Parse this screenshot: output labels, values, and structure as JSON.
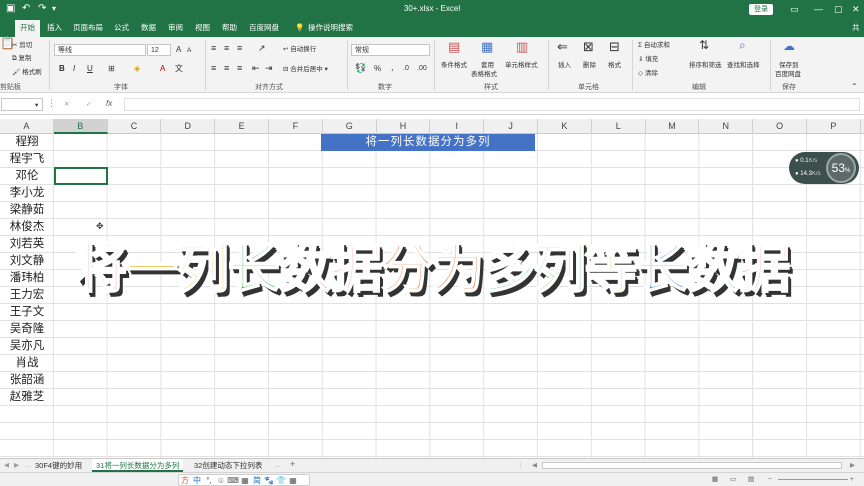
{
  "titlebar": {
    "window_title": "30+.xlsx - Excel",
    "login_label": "登录"
  },
  "tabs": [
    "开始",
    "插入",
    "页面布局",
    "公式",
    "数据",
    "审阅",
    "视图",
    "帮助",
    "百度网盘",
    "操作说明搜索"
  ],
  "active_tab": 0,
  "ribbon": {
    "clipboard": {
      "cut": "剪切",
      "copy": "复制",
      "format_painter": "格式刷",
      "group": "剪贴板"
    },
    "font": {
      "name": "等线",
      "size": "12",
      "grow": "A",
      "shrink": "A",
      "bold": "B",
      "italic": "I",
      "underline": "U",
      "group": "字体"
    },
    "alignment": {
      "wrap": "自动换行",
      "merge": "合并后居中",
      "group": "对齐方式"
    },
    "number": {
      "format": "常规",
      "percent": "%",
      "comma": ",",
      "group": "数字"
    },
    "styles": {
      "conditional": "条件格式",
      "table": "套用",
      "table2": "表格格式",
      "cell_styles": "单元格样式",
      "group": "样式"
    },
    "cells": {
      "insert": "插入",
      "delete": "删除",
      "format": "格式",
      "group": "单元格"
    },
    "editing": {
      "autosum": "自动求和",
      "fill": "填充",
      "clear": "清除",
      "sort": "排序和筛选",
      "find": "查找和选择",
      "group": "编辑"
    },
    "save": {
      "save_to": "保存到",
      "baidu": "百度网盘",
      "group": "保存"
    }
  },
  "formula_bar": {
    "name_box": "",
    "content": "",
    "cancel": "✕",
    "enter": "✓",
    "fx": "fx"
  },
  "columns": [
    "A",
    "B",
    "C",
    "D",
    "E",
    "F",
    "G",
    "H",
    "I",
    "J",
    "K",
    "L",
    "M",
    "N",
    "O",
    "P"
  ],
  "selected_column": "B",
  "names": [
    "程翔",
    "程宇飞",
    "邓伦",
    "李小龙",
    "梁静茹",
    "林俊杰",
    "刘若英",
    "刘文静",
    "潘玮柏",
    "王力宏",
    "王子文",
    "吴奇隆",
    "吴亦凡",
    "肖战",
    "张韶涵",
    "赵雅芝"
  ],
  "banner_text": "将一列长数据分为多列",
  "overlay": {
    "chars": [
      "将",
      "一",
      "列",
      "长",
      "数",
      "据",
      "分",
      "为",
      "多",
      "列",
      "等",
      "长",
      "数",
      "据"
    ],
    "colors": [
      "#e6427a",
      "#f0b42a",
      "#f0b42a",
      "#4fb35e",
      "#e6427a",
      "#e6427a",
      "#f07030",
      "#f07030",
      "#4fb35e",
      "#4fb35e",
      "#f0b42a",
      "#4a8fd8",
      "#4a8fd8",
      "#e6427a"
    ]
  },
  "speed_widget": {
    "up": "0.1",
    "up_unit": "K/s",
    "down": "14.3",
    "down_unit": "K/s",
    "percent": "53",
    "percent_unit": "%"
  },
  "sheets": [
    "30F4键的妙用",
    "31将一列长数据分为多列",
    "32创建动态下拉列表"
  ],
  "active_sheet": 1,
  "add_sheet": "+",
  "ime": [
    "方",
    "中",
    "°,",
    "☺",
    "⌨",
    "▦",
    "简",
    "🐾",
    "👕",
    "▦"
  ],
  "colors": {
    "excel_green": "#217346",
    "banner_blue": "#4472c4"
  }
}
